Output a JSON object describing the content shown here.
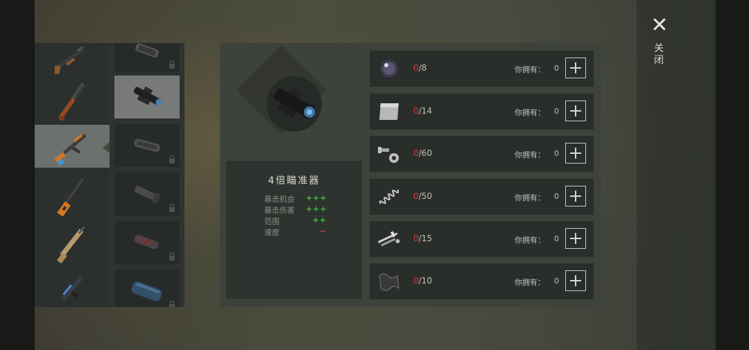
{
  "close": {
    "icon": "close-icon",
    "label": "关闭"
  },
  "weapons": [
    {
      "name": "shotgun-pump",
      "selected": false
    },
    {
      "name": "double-barrel-shotgun",
      "selected": false
    },
    {
      "name": "ak-rifle",
      "selected": true
    },
    {
      "name": "sniper-rifle",
      "selected": false
    },
    {
      "name": "scar-rifle",
      "selected": false
    },
    {
      "name": "m4-rifle",
      "selected": false
    }
  ],
  "attachments": [
    {
      "name": "muzzle-attachment",
      "locked": true,
      "selected": false
    },
    {
      "name": "4x-scope",
      "locked": false,
      "selected": true
    },
    {
      "name": "compensator",
      "locked": true,
      "selected": false
    },
    {
      "name": "flash-hider",
      "locked": true,
      "selected": false
    },
    {
      "name": "muzzle-brake",
      "locked": true,
      "selected": false
    },
    {
      "name": "suppressor",
      "locked": true,
      "selected": false
    }
  ],
  "item": {
    "title": "4倍瞄准器",
    "stats": [
      {
        "label": "暴击机会",
        "value": "+++"
      },
      {
        "label": "暴击伤害",
        "value": "+++"
      },
      {
        "label": "范围",
        "value": "++"
      },
      {
        "label": "速度",
        "value": "−"
      }
    ]
  },
  "materials": [
    {
      "icon": "lens-icon",
      "have": "0",
      "need": "/8",
      "owned_label": "你拥有：",
      "owned": "0"
    },
    {
      "icon": "metal-sheet-icon",
      "have": "0",
      "need": "/14",
      "owned_label": "你拥有：",
      "owned": "0"
    },
    {
      "icon": "bolts-icon",
      "have": "0",
      "need": "/60",
      "owned_label": "你拥有：",
      "owned": "0"
    },
    {
      "icon": "spring-icon",
      "have": "0",
      "need": "/50",
      "owned_label": "你拥有：",
      "owned": "0"
    },
    {
      "icon": "gun-parts-icon",
      "have": "0",
      "need": "/15",
      "owned_label": "你拥有：",
      "owned": "0"
    },
    {
      "icon": "rubber-sheet-icon",
      "have": "0",
      "need": "/10",
      "owned_label": "你拥有：",
      "owned": "0"
    }
  ]
}
